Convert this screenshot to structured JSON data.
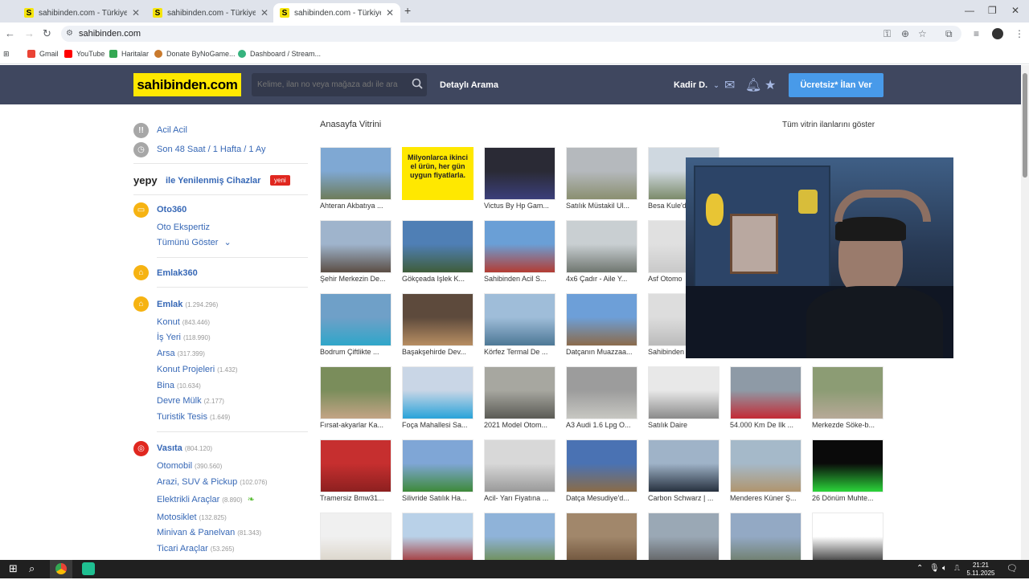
{
  "browser": {
    "tabs": [
      {
        "title": "sahibinden.com - Türkiye'nin Ö",
        "favicon": "S"
      },
      {
        "title": "sahibinden.com - Türkiye'nin Ö",
        "favicon": "S"
      },
      {
        "title": "sahibinden.com - Türkiye'nin Ö",
        "favicon": "S"
      }
    ],
    "url": "sahibinden.com",
    "bookmarks": [
      "Gmail",
      "YouTube",
      "Haritalar",
      "Donate ByNoGame...",
      "Dashboard / Stream..."
    ]
  },
  "header": {
    "logo": "sahibinden.com",
    "search_placeholder": "Kelime, ilan no veya mağaza adı ile ara",
    "detailed_search": "Detaylı Arama",
    "user": "Kadir D.",
    "post_button": "Ücretsiz* İlan Ver"
  },
  "sidebar": {
    "acil": "Acil Acil",
    "recent": "Son 48 Saat / 1 Hafta / 1 Ay",
    "yepy_logo": "yepy",
    "yepy_text": "ile Yenilenmiş Cihazlar",
    "yepy_badge": "yeni",
    "oto360": "Oto360",
    "oto_ekspertiz": "Oto Ekspertiz",
    "show_all": "Tümünü Göster",
    "emlak360": "Emlak360",
    "emlak": {
      "label": "Emlak",
      "count": "(1.294.296)"
    },
    "emlak_items": [
      {
        "label": "Konut",
        "count": "(843.446)"
      },
      {
        "label": "İş Yeri",
        "count": "(118.990)"
      },
      {
        "label": "Arsa",
        "count": "(317.399)"
      },
      {
        "label": "Konut Projeleri",
        "count": "(1.432)"
      },
      {
        "label": "Bina",
        "count": "(10.634)"
      },
      {
        "label": "Devre Mülk",
        "count": "(2.177)"
      },
      {
        "label": "Turistik Tesis",
        "count": "(1.649)"
      }
    ],
    "vasita": {
      "label": "Vasıta",
      "count": "(804.120)"
    },
    "vasita_items": [
      {
        "label": "Otomobil",
        "count": "(390.560)"
      },
      {
        "label": "Arazi, SUV & Pickup",
        "count": "(102.076)"
      },
      {
        "label": "Elektrikli Araçlar",
        "count": "(8.890)"
      },
      {
        "label": "Motosiklet",
        "count": "(132.825)"
      },
      {
        "label": "Minivan & Panelvan",
        "count": "(81.343)"
      },
      {
        "label": "Ticari Araçlar",
        "count": "(53.265)"
      }
    ]
  },
  "main": {
    "title": "Anasayfa Vitrini",
    "show_all": "Tüm vitrin ilanlarını göster",
    "promo_text": "Milyonlarca ikinci el ürün, her gün uygun fiyatlarla.",
    "rows": [
      [
        "Ahteran Akbatıya ...",
        "",
        "Victus By Hp Gam...",
        "Satılık Müstakil Ul...",
        "Besa Kule'd",
        "",
        ""
      ],
      [
        "Şehir Merkezin De...",
        "Gökçeada Işlek K...",
        "Sahibinden Acil S...",
        "4x6 Çadır - Aile Y...",
        "Asf Otomo",
        "",
        ""
      ],
      [
        "Bodrum Çiftlikte ...",
        "Başakşehirde Dev...",
        "Körfez Termal De ...",
        "Datçanın Muazzaa...",
        "Sahibinden",
        "",
        ""
      ],
      [
        "Fırsat-akyarlar Ka...",
        "Foça Mahallesi Sa...",
        "2021 Model Otom...",
        "A3 Audi 1.6 Lpg O...",
        "Satılık Daire",
        "54.000 Km De Ilk ...",
        "Merkezde Söke-b..."
      ],
      [
        "Tramersiz Bmw31...",
        "Silivride Satılık Ha...",
        "Acil- Yarı Fiyatına ...",
        "Datça Mesudiye'd...",
        "Carbon Schwarz | ...",
        "Menderes Küner Ş...",
        "26 Dönüm Muhte..."
      ],
      [
        "",
        "",
        "",
        "",
        "",
        "",
        ""
      ]
    ]
  },
  "taskbar": {
    "time": "21:21",
    "date": "5.11.2025"
  },
  "colors": {
    "header": "#3f475f",
    "logo": "#ffe800",
    "link": "#3768b6",
    "button": "#489ae9"
  }
}
